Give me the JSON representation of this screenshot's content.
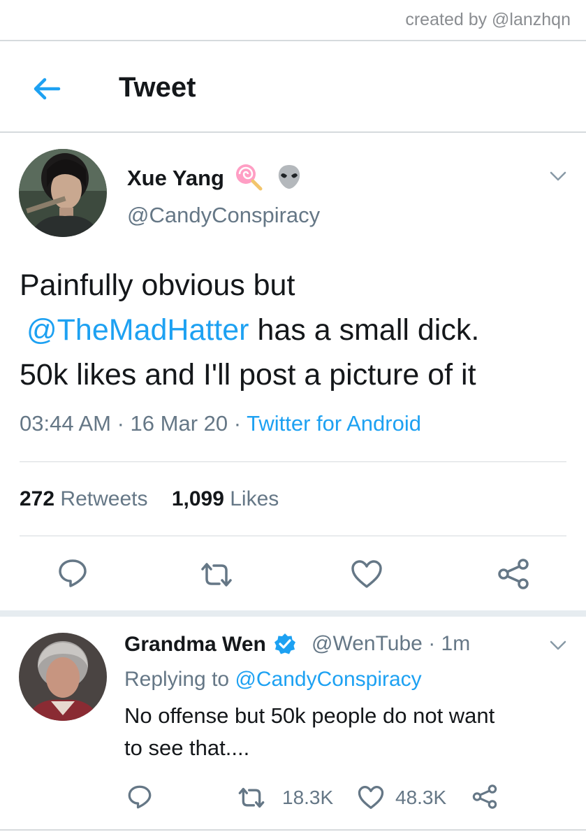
{
  "watermark": "created by @lanzhqn",
  "header": {
    "title": "Tweet",
    "back_icon": "arrow-left-icon"
  },
  "tweet": {
    "author_name": "Xue Yang",
    "author_emojis": [
      "lollipop-emoji",
      "alien-emoji"
    ],
    "author_handle": "@CandyConspiracy",
    "text": {
      "line1": "Painfully obvious but",
      "mention": "@TheMadHatter",
      "line2_rest": " has a small dick.",
      "line3": "50k likes and I'll post a picture of it"
    },
    "time": "03:44 AM",
    "date": "16 Mar 20",
    "source": "Twitter for Android",
    "retweets_count": "272",
    "retweets_label": "Retweets",
    "likes_count": "1,099",
    "likes_label": "Likes",
    "actions": [
      "reply-icon",
      "retweet-icon",
      "like-icon",
      "share-icon"
    ]
  },
  "reply": {
    "author_name": "Grandma Wen",
    "verified_icon": "verified-badge-icon",
    "author_handle": "@WenTube",
    "time": "1m",
    "replying_label": "Replying to",
    "replying_handle": "@CandyConspiracy",
    "text_line1": "No offense but 50k people do not want",
    "text_line2": "to see that....",
    "retweets": "18.3K",
    "likes": "48.3K"
  },
  "colors": {
    "accent": "#1da1f2",
    "secondary_text": "#657786",
    "divider": "#d6dadd"
  }
}
